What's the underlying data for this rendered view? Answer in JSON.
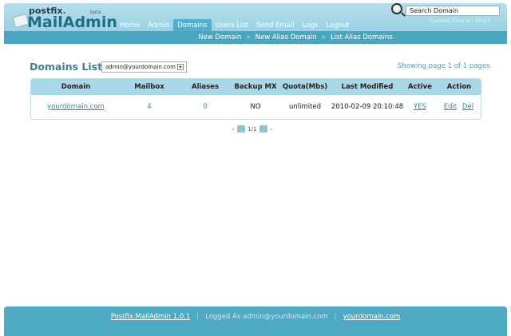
{
  "header": {
    "logo_small": "postfix",
    "logo_big": "MailAdmin",
    "beta": "beta",
    "search_value": "Search Domain",
    "current_time": "Current Time is : 20:23",
    "nav": [
      "Home",
      "Admin",
      "Domains",
      "Users List",
      "Send Email",
      "Logs",
      "Logout"
    ],
    "subnav": [
      "New Domain",
      "New Alias Domain",
      "List Alias Domains"
    ],
    "subnav_sep": "»"
  },
  "main": {
    "title": "Domains List",
    "select_value": "admin@yourdomain.com",
    "showing": "Showing page 1 of 1 pages",
    "columns": [
      "Domain",
      "Mailbox",
      "Aliases",
      "Backup MX",
      "Quota(Mbs)",
      "Last Modified",
      "Active",
      "Action"
    ],
    "rows": [
      {
        "domain": "yourdomain.com",
        "mailbox": "4",
        "aliases": "0",
        "backup_mx": "NO",
        "quota": "unlimited",
        "modified": "2010-02-09 20:10:48",
        "active": "YES",
        "edit": "Edit",
        "del": "Del"
      }
    ],
    "pager": {
      "first": "«",
      "page": "1/1",
      "last": "»"
    }
  },
  "footer": {
    "version": "Postfix.MailAdmin 1.0.1",
    "sep": "|",
    "logged": "Logged As admin@yourdomain.com",
    "domain": "yourdomain.com"
  }
}
